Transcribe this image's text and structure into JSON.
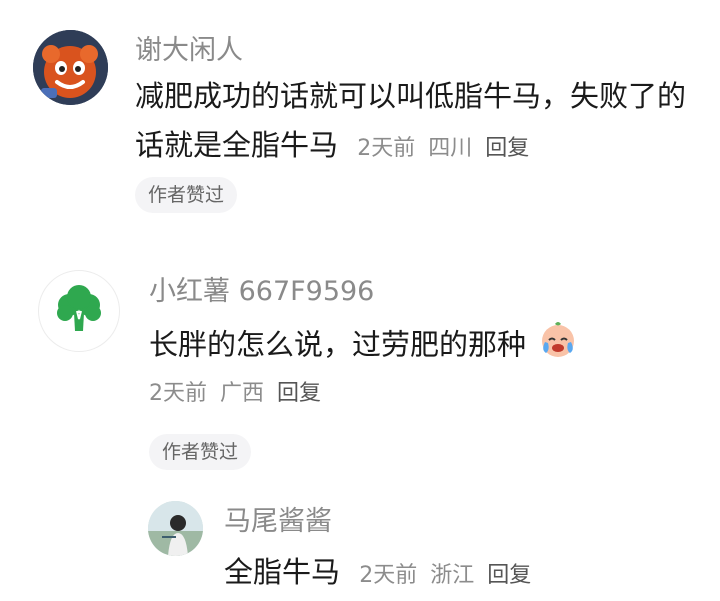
{
  "comments": [
    {
      "username": "谢大闲人",
      "text_line1": "减肥成功的话就可以叫低脂牛马，失败了的",
      "text_line2": "话就是全脂牛马",
      "time": "2天前",
      "location": "四川",
      "reply_label": "回复",
      "badge": "作者赞过"
    },
    {
      "username": "小红薯 667F9596",
      "text": "长胖的怎么说，过劳肥的那种",
      "emoji": "crying-face-emoji",
      "time": "2天前",
      "location": "广西",
      "reply_label": "回复",
      "badge": "作者赞过"
    },
    {
      "username": "马尾酱酱",
      "text": "全脂牛马",
      "time": "2天前",
      "location": "浙江",
      "reply_label": "回复"
    }
  ]
}
